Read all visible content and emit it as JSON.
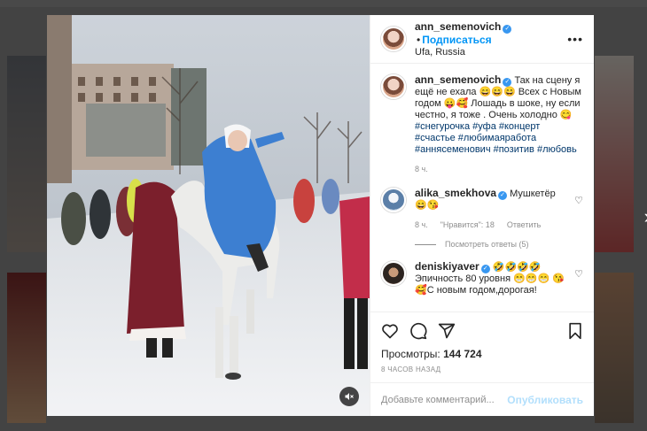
{
  "post": {
    "username": "ann_semenovich",
    "follow_label": "Подписаться",
    "location": "Ufa, Russia",
    "caption_line1": "Так на сцену я ещё не ехала 😄😄😄",
    "caption_line2": "Всех с Новым годом 😛🥰 Лошадь в шоке, ну если честно, я тоже . Очень холодно 😋",
    "caption_tags": "#снегурочка #уфа #концерт #счастье #любимаяработа #аннясеменович #позитив #любовь",
    "caption_time": "8 ч."
  },
  "comments": [
    {
      "username": "alika_smekhova",
      "text": "Мушкетёр 😄😘",
      "time": "8 ч.",
      "likes": "\"Нравится\": 18",
      "reply": "Ответить",
      "view_replies": "Посмотреть ответы (5)"
    },
    {
      "username": "deniskiyaver",
      "text": "🤣🤣🤣🤣 Эпичность 80 уровня 😁😁😁 😘🥰С новым годом,дорогая!"
    }
  ],
  "actions": {
    "views_label": "Просмотры:",
    "views_count": "144 724",
    "date": "8 ЧАСОВ НАЗАД"
  },
  "add_comment": {
    "placeholder": "Добавьте комментарий...",
    "publish_label": "Опубликовать"
  },
  "colors": {
    "accent": "#0095f6",
    "verified": "#3897f0",
    "publish_disabled": "#b2dffc"
  },
  "icons": [
    "heart-icon",
    "comment-icon",
    "share-icon",
    "bookmark-icon",
    "more-icon",
    "mute-icon",
    "next-arrow-icon",
    "verified-icon"
  ]
}
